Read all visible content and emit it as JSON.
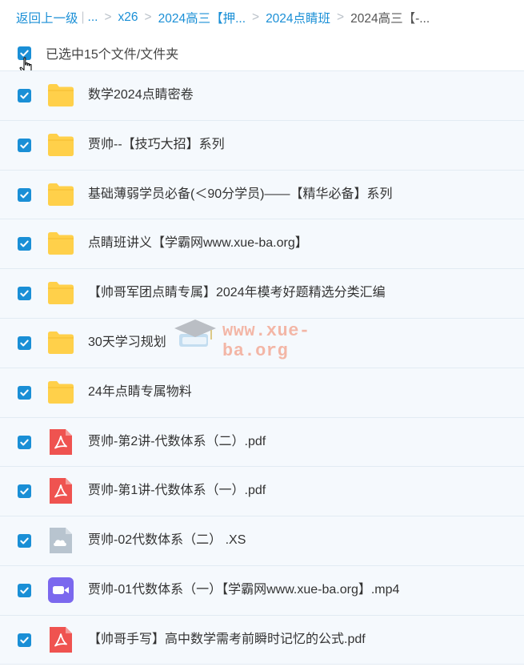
{
  "breadcrumb": {
    "back": "返回上一级",
    "ellipsis": "...",
    "items": [
      "x26",
      "2024高三【押...",
      "2024点睛班"
    ],
    "current": "2024高三【-..."
  },
  "selection": {
    "label": "已选中15个文件/文件夹",
    "checked": true
  },
  "files": [
    {
      "name": "数学2024点睛密卷",
      "type": "folder"
    },
    {
      "name": "贾帅--【技巧大招】系列",
      "type": "folder"
    },
    {
      "name": "基础薄弱学员必备(＜90分学员)——【精华必备】系列",
      "type": "folder"
    },
    {
      "name": "点睛班讲义【学霸网www.xue-ba.org】",
      "type": "folder"
    },
    {
      "name": "【帅哥军团点睛专属】2024年模考好题精选分类汇编",
      "type": "folder"
    },
    {
      "name": "30天学习规划",
      "type": "folder"
    },
    {
      "name": "24年点睛专属物料",
      "type": "folder"
    },
    {
      "name": "贾帅-第2讲-代数体系（二）.pdf",
      "type": "pdf"
    },
    {
      "name": "贾帅-第1讲-代数体系（一）.pdf",
      "type": "pdf"
    },
    {
      "name": "贾帅-02代数体系（二） .XS",
      "type": "cloud"
    },
    {
      "name": "贾帅-01代数体系（一）【学霸网www.xue-ba.org】.mp4",
      "type": "video"
    },
    {
      "name": "【帅哥手写】高中数学需考前瞬时记忆的公式.pdf",
      "type": "pdf"
    }
  ],
  "watermark": "www.xue-ba.org",
  "colors": {
    "accent": "#1a8fd6",
    "folder": "#ffd04a",
    "pdf": "#ef5350",
    "video": "#7b68ee",
    "cloud": "#b8c4cf"
  }
}
